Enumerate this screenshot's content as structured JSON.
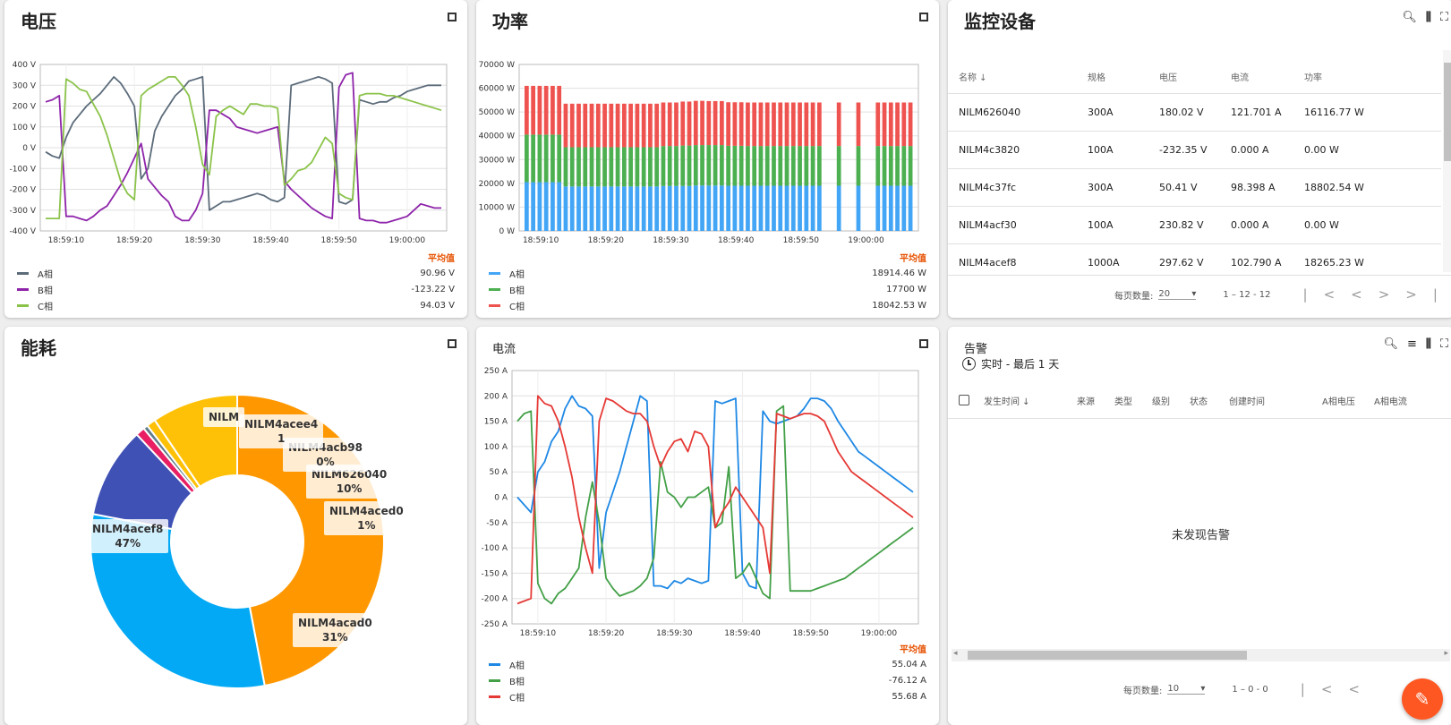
{
  "colors": {
    "a": "#1e88e5",
    "b": "#43a047",
    "c": "#e53935",
    "accent": "#e65100"
  },
  "voltage": {
    "title": "电压",
    "avg_label": "平均值",
    "legend": [
      {
        "name": "A相",
        "value": "90.96 V",
        "color": "#5c6b7a"
      },
      {
        "name": "B相",
        "value": "-123.22 V",
        "color": "#8e24aa"
      },
      {
        "name": "C相",
        "value": "94.03 V",
        "color": "#8bc34a"
      }
    ]
  },
  "power": {
    "title": "功率",
    "avg_label": "平均值",
    "legend": [
      {
        "name": "A相",
        "value": "18914.46 W",
        "color": "#42a5f5"
      },
      {
        "name": "B相",
        "value": "17700 W",
        "color": "#4caf50"
      },
      {
        "name": "C相",
        "value": "18042.53 W",
        "color": "#ef5350"
      }
    ]
  },
  "devices": {
    "title": "监控设备",
    "columns": [
      "名称",
      "规格",
      "电压",
      "电流",
      "功率"
    ],
    "rows": [
      [
        "NILM626040",
        "300A",
        "180.02 V",
        "121.701 A",
        "16116.77 W"
      ],
      [
        "NILM4c3820",
        "100A",
        "-232.35 V",
        "0.000 A",
        "0.00 W"
      ],
      [
        "NILM4c37fc",
        "300A",
        "50.41 V",
        "98.398 A",
        "18802.54 W"
      ],
      [
        "NILM4acf30",
        "100A",
        "230.82 V",
        "0.000 A",
        "0.00 W"
      ],
      [
        "NILM4acef8",
        "1000A",
        "297.62 V",
        "102.790 A",
        "18265.23 W"
      ]
    ],
    "per_page_label": "每页数量:",
    "per_page": "20",
    "range": "1 – 12 - 12"
  },
  "energy": {
    "title": "能耗",
    "labels": [
      {
        "name": "NILM4acef8",
        "pct": "47%"
      },
      {
        "name": "NILM4acad0",
        "pct": "31%"
      },
      {
        "name": "NILM626040",
        "pct": "10%"
      },
      {
        "name": "NILM4aced0",
        "pct": "1%"
      },
      {
        "name": "NILM4acb98",
        "pct": "0%"
      },
      {
        "name": "NILM4acee4",
        "pct": "1"
      },
      {
        "name": "NILM",
        "pct": ""
      }
    ]
  },
  "current": {
    "title": "电流",
    "avg_label": "平均值",
    "legend": [
      {
        "name": "A相",
        "value": "55.04 A",
        "color": "#1e88e5"
      },
      {
        "name": "B相",
        "value": "-76.12 A",
        "color": "#43a047"
      },
      {
        "name": "C相",
        "value": "55.68 A",
        "color": "#e53935"
      }
    ]
  },
  "alarms": {
    "title": "告警",
    "range": "实时 - 最后 1 天",
    "columns": [
      "发生时间",
      "来源",
      "类型",
      "级别",
      "状态",
      "创建时间",
      "A相电压",
      "A相电流"
    ],
    "empty": "未发现告警",
    "per_page_label": "每页数量:",
    "per_page": "10",
    "range_text": "1 – 0 - 0"
  },
  "chart_data": [
    {
      "type": "line",
      "title": "电压",
      "x": [
        "18:59:07",
        "18:59:08",
        "18:59:09",
        "18:59:10",
        "18:59:11",
        "18:59:12",
        "18:59:13",
        "18:59:14",
        "18:59:15",
        "18:59:16",
        "18:59:17",
        "18:59:18",
        "18:59:19",
        "18:59:20",
        "18:59:21",
        "18:59:22",
        "18:59:23",
        "18:59:24",
        "18:59:25",
        "18:59:26",
        "18:59:27",
        "18:59:28",
        "18:59:29",
        "18:59:30",
        "18:59:31",
        "18:59:32",
        "18:59:33",
        "18:59:34",
        "18:59:35",
        "18:59:36",
        "18:59:37",
        "18:59:38",
        "18:59:39",
        "18:59:40",
        "18:59:41",
        "18:59:42",
        "18:59:43",
        "18:59:44",
        "18:59:45",
        "18:59:46",
        "18:59:47",
        "18:59:48",
        "18:59:49",
        "18:59:50",
        "18:59:51",
        "18:59:52",
        "18:59:53",
        "18:59:54",
        "18:59:55",
        "18:59:56",
        "18:59:57",
        "18:59:58",
        "18:59:59",
        "19:00:00",
        "19:00:01",
        "19:00:02",
        "19:00:03",
        "19:00:04",
        "19:00:05"
      ],
      "ylim": [
        -400,
        400
      ],
      "yticks": [
        -400,
        -300,
        -200,
        -100,
        0,
        100,
        200,
        300,
        400
      ],
      "yunit": " V",
      "xticks": [
        "18:59:10",
        "18:59:20",
        "18:59:30",
        "18:59:40",
        "18:59:50",
        "19:00:00"
      ],
      "series": [
        {
          "name": "A相",
          "values": [
            -20,
            -40,
            -50,
            50,
            120,
            160,
            200,
            230,
            260,
            300,
            340,
            310,
            260,
            200,
            -150,
            -100,
            80,
            150,
            200,
            250,
            280,
            320,
            330,
            340,
            -300,
            -280,
            -260,
            -260,
            -250,
            -240,
            -230,
            -220,
            -230,
            -250,
            -260,
            -240,
            300,
            310,
            320,
            330,
            340,
            330,
            310,
            -260,
            -270,
            -250,
            230,
            220,
            210,
            220,
            220,
            240,
            250,
            270,
            280,
            290,
            300,
            300,
            300
          ],
          "color": "#5c6b7a"
        },
        {
          "name": "B相",
          "values": [
            220,
            230,
            250,
            -330,
            -330,
            -340,
            -350,
            -330,
            -300,
            -280,
            -230,
            -180,
            -120,
            -50,
            20,
            -150,
            -190,
            -230,
            -260,
            -330,
            -350,
            -350,
            -300,
            -220,
            180,
            180,
            160,
            140,
            100,
            90,
            80,
            70,
            80,
            90,
            100,
            -160,
            -200,
            -230,
            -260,
            -290,
            -310,
            -330,
            -340,
            290,
            350,
            360,
            -340,
            -350,
            -350,
            -360,
            -360,
            -350,
            -340,
            -330,
            -300,
            -270,
            -280,
            -290,
            -290
          ],
          "color": "#8e24aa"
        },
        {
          "name": "C相",
          "values": [
            -340,
            -340,
            -340,
            330,
            310,
            280,
            270,
            210,
            150,
            60,
            -50,
            -160,
            -220,
            -250,
            250,
            280,
            300,
            320,
            340,
            340,
            300,
            250,
            100,
            -80,
            -130,
            150,
            180,
            200,
            180,
            160,
            210,
            210,
            200,
            200,
            190,
            -180,
            -150,
            -110,
            -100,
            -70,
            -10,
            50,
            20,
            -220,
            -240,
            -250,
            250,
            260,
            260,
            260,
            250,
            250,
            240,
            230,
            220,
            210,
            200,
            190,
            180
          ],
          "color": "#8bc34a"
        }
      ]
    },
    {
      "type": "bar",
      "title": "功率",
      "stacked": true,
      "ylim": [
        0,
        70000
      ],
      "yticks": [
        0,
        10000,
        20000,
        30000,
        40000,
        50000,
        60000,
        70000
      ],
      "yunit": " W",
      "xticks": [
        "18:59:10",
        "18:59:20",
        "18:59:30",
        "18:59:40",
        "18:59:50",
        "19:00:00"
      ],
      "categories_count": 60,
      "gaps": [
        46,
        47,
        49,
        50,
        52,
        53
      ],
      "series": [
        {
          "name": "A相",
          "values": [
            20500,
            20500,
            20500,
            20500,
            20500,
            20500,
            18700,
            18700,
            18700,
            18700,
            18700,
            18700,
            18700,
            18700,
            18700,
            18700,
            18700,
            18700,
            18700,
            18700,
            18700,
            18900,
            18900,
            18900,
            18900,
            18900,
            19100,
            19100,
            19100,
            19100,
            19100,
            19000,
            19000,
            19000,
            19000,
            19000,
            19000,
            19000,
            19000,
            19000,
            19000,
            19000,
            19000,
            19000,
            19000,
            19000,
            0,
            0,
            19000,
            0,
            0,
            19000,
            0,
            0,
            19000,
            19000,
            19000,
            19000,
            19000,
            19000
          ],
          "color": "#42a5f5"
        },
        {
          "name": "B相",
          "values": [
            20000,
            20000,
            20000,
            20000,
            20000,
            20000,
            16500,
            16500,
            16500,
            16500,
            16500,
            16500,
            16500,
            16500,
            16500,
            16500,
            16500,
            16500,
            16500,
            16500,
            16500,
            16800,
            16800,
            16800,
            17000,
            17000,
            17000,
            17000,
            17000,
            17000,
            17000,
            16800,
            16800,
            16800,
            16700,
            16700,
            16700,
            16700,
            16700,
            16700,
            16700,
            16700,
            16700,
            16700,
            16700,
            16700,
            0,
            0,
            16700,
            0,
            0,
            16700,
            0,
            0,
            16700,
            16700,
            16700,
            16700,
            16700,
            16700
          ],
          "color": "#4caf50"
        },
        {
          "name": "C相",
          "values": [
            20500,
            20500,
            20500,
            20500,
            20500,
            20500,
            18300,
            18300,
            18300,
            18300,
            18300,
            18300,
            18300,
            18300,
            18300,
            18300,
            18300,
            18300,
            18300,
            18300,
            18300,
            18300,
            18300,
            18300,
            18500,
            18500,
            18600,
            18600,
            18500,
            18500,
            18500,
            18300,
            18300,
            18300,
            18300,
            18300,
            18300,
            18300,
            18300,
            18300,
            18300,
            18300,
            18300,
            18300,
            18300,
            18300,
            0,
            0,
            18300,
            0,
            0,
            18300,
            0,
            0,
            18300,
            18300,
            18300,
            18300,
            18300,
            18300
          ],
          "color": "#ef5350"
        }
      ]
    },
    {
      "type": "pie",
      "title": "能耗",
      "donut": true,
      "categories": [
        "NILM4acef8",
        "NILM4acad0",
        "NILM626040",
        "NILM4aced0",
        "NILM4acb98",
        "NILM4acee4",
        "NILM"
      ],
      "values": [
        47,
        31,
        10,
        1,
        0.5,
        1,
        9.5
      ],
      "colors": [
        "#ff9800",
        "#03a9f4",
        "#3f51b5",
        "#e91e63",
        "#607d8b",
        "#ffc107",
        "#ffc107"
      ]
    },
    {
      "type": "line",
      "title": "电流",
      "x": [
        "18:59:07",
        "18:59:08",
        "18:59:09",
        "18:59:10",
        "18:59:11",
        "18:59:12",
        "18:59:13",
        "18:59:14",
        "18:59:15",
        "18:59:16",
        "18:59:17",
        "18:59:18",
        "18:59:19",
        "18:59:20",
        "18:59:21",
        "18:59:22",
        "18:59:23",
        "18:59:24",
        "18:59:25",
        "18:59:26",
        "18:59:27",
        "18:59:28",
        "18:59:29",
        "18:59:30",
        "18:59:31",
        "18:59:32",
        "18:59:33",
        "18:59:34",
        "18:59:35",
        "18:59:36",
        "18:59:37",
        "18:59:38",
        "18:59:39",
        "18:59:40",
        "18:59:41",
        "18:59:42",
        "18:59:43",
        "18:59:44",
        "18:59:45",
        "18:59:46",
        "18:59:47",
        "18:59:48",
        "18:59:49",
        "18:59:50",
        "18:59:51",
        "18:59:52",
        "18:59:53",
        "18:59:54",
        "18:59:55",
        "18:59:56",
        "18:59:57",
        "18:59:58",
        "18:59:59",
        "19:00:00",
        "19:00:01",
        "19:00:02",
        "19:00:03",
        "19:00:04",
        "19:00:05"
      ],
      "ylim": [
        -250,
        250
      ],
      "yticks": [
        -250,
        -200,
        -150,
        -100,
        -50,
        0,
        50,
        100,
        150,
        200,
        250
      ],
      "yunit": " A",
      "xticks": [
        "18:59:10",
        "18:59:20",
        "18:59:30",
        "18:59:40",
        "18:59:50",
        "19:00:00"
      ],
      "series": [
        {
          "name": "A相",
          "values": [
            0,
            -15,
            -30,
            50,
            70,
            110,
            130,
            175,
            200,
            180,
            175,
            160,
            -140,
            -30,
            10,
            50,
            100,
            150,
            200,
            190,
            -175,
            -175,
            -180,
            -165,
            -170,
            -160,
            -165,
            -170,
            -165,
            190,
            185,
            190,
            195,
            -150,
            -175,
            -180,
            170,
            150,
            145,
            150,
            155,
            160,
            175,
            195,
            195,
            190,
            175,
            150,
            130,
            110,
            90,
            80,
            70,
            60,
            50,
            40,
            30,
            20,
            10
          ],
          "color": "#1e88e5"
        },
        {
          "name": "B相",
          "values": [
            150,
            165,
            170,
            -170,
            -200,
            -210,
            -190,
            -180,
            -160,
            -140,
            -40,
            30,
            -50,
            -160,
            -180,
            -195,
            -190,
            -185,
            -175,
            -160,
            -120,
            70,
            10,
            0,
            -20,
            0,
            0,
            10,
            20,
            -60,
            -50,
            60,
            -160,
            -150,
            -130,
            -160,
            -190,
            -200,
            170,
            180,
            -185,
            -185,
            -185,
            -185,
            -180,
            -175,
            -170,
            -165,
            -160,
            -150,
            -140,
            -130,
            -120,
            -110,
            -100,
            -90,
            -80,
            -70,
            -60
          ],
          "color": "#43a047"
        },
        {
          "name": "C相",
          "values": [
            -210,
            -205,
            -200,
            200,
            185,
            180,
            150,
            100,
            40,
            -40,
            -100,
            -150,
            150,
            195,
            190,
            180,
            170,
            165,
            165,
            150,
            100,
            60,
            90,
            110,
            115,
            90,
            130,
            125,
            100,
            -60,
            -30,
            -10,
            20,
            0,
            -20,
            -40,
            -60,
            -150,
            165,
            160,
            155,
            160,
            165,
            165,
            160,
            150,
            120,
            90,
            70,
            50,
            40,
            30,
            20,
            10,
            0,
            -10,
            -20,
            -30,
            -40
          ],
          "color": "#e53935"
        }
      ]
    }
  ]
}
